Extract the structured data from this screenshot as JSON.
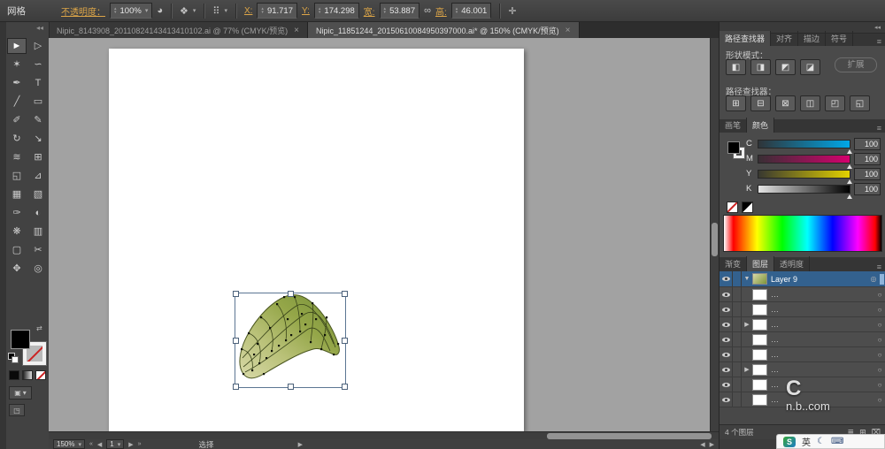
{
  "control_bar": {
    "selection_label": "网格",
    "opacity_label": "不透明度：",
    "opacity_value": "100%",
    "x_label": "X:",
    "x_value": "91.717",
    "y_label": "Y:",
    "y_value": "174.298",
    "w_label": "宽:",
    "w_value": "53.887",
    "h_label": "高:",
    "h_value": "46.001",
    "icons": {
      "opacity_circle": "◕",
      "style_drop": "❖",
      "align_grid": "⠿",
      "link": "∞",
      "transform": "✛",
      "dropdown": "▾",
      "up": "▴",
      "down": "▾"
    }
  },
  "tabs": [
    {
      "title": "Nipic_8143908_20110824143413410102.ai @ 77% (CMYK/预览)",
      "close": "×"
    },
    {
      "title": "Nipic_11851244_20150610084950397000.ai* @ 150% (CMYK/预览)",
      "close": "×"
    }
  ],
  "tool_panel": {
    "collapse": "◂◂"
  },
  "tools": [
    {
      "n": "selection",
      "g": "►"
    },
    {
      "n": "direct-selection",
      "g": "▷"
    },
    {
      "n": "magic-wand",
      "g": "✶"
    },
    {
      "n": "lasso",
      "g": "∽"
    },
    {
      "n": "pen",
      "g": "✒"
    },
    {
      "n": "type",
      "g": "T"
    },
    {
      "n": "line-segment",
      "g": "╱"
    },
    {
      "n": "rectangle",
      "g": "▭"
    },
    {
      "n": "paintbrush",
      "g": "✐"
    },
    {
      "n": "pencil",
      "g": "✎"
    },
    {
      "n": "rotate",
      "g": "↻"
    },
    {
      "n": "scale",
      "g": "↘"
    },
    {
      "n": "width-tool",
      "g": "≋"
    },
    {
      "n": "free-transform",
      "g": "⊞"
    },
    {
      "n": "shape-builder",
      "g": "◱"
    },
    {
      "n": "perspective-grid",
      "g": "⊿"
    },
    {
      "n": "mesh",
      "g": "▦"
    },
    {
      "n": "gradient",
      "g": "▧"
    },
    {
      "n": "eyedropper",
      "g": "✑"
    },
    {
      "n": "blend",
      "g": "◐"
    },
    {
      "n": "symbol-sprayer",
      "g": "❋"
    },
    {
      "n": "column-graph",
      "g": "▥"
    },
    {
      "n": "artboard",
      "g": "▢"
    },
    {
      "n": "slice",
      "g": "✂"
    },
    {
      "n": "hand",
      "g": "✥"
    },
    {
      "n": "zoom",
      "g": "◎"
    }
  ],
  "tool_extras": {
    "swap": "⇄",
    "mode_label": "▣",
    "mode_drop": "▾",
    "screen": "◳"
  },
  "right": {
    "collapse": "◂◂",
    "menu_icon": "≡",
    "panel_tabs_top": [
      "路径查找器",
      "对齐",
      "描边",
      "符号"
    ],
    "shape_modes_label": "形状模式：",
    "shape_mode_icons": [
      "◧",
      "◨",
      "◩",
      "◪"
    ],
    "expand_button": "扩展",
    "pathfinder_label": "路径查找器：",
    "pathfinder_icons": [
      "⊞",
      "⊟",
      "⊠",
      "◫",
      "◰",
      "◱"
    ],
    "panel_tabs_mid": [
      "画笔",
      "颜色"
    ],
    "channels": [
      {
        "label": "C",
        "value": "100"
      },
      {
        "label": "M",
        "value": "100"
      },
      {
        "label": "Y",
        "value": "100"
      },
      {
        "label": "K",
        "value": "100"
      }
    ],
    "panel_tabs_low": [
      "渐变",
      "图层",
      "透明度"
    ],
    "layers": {
      "expand_open": "▼",
      "selected_name": "Layer 9",
      "target_sel": "◎",
      "target": "○",
      "rows": [
        {
          "label": "…",
          "tri": ""
        },
        {
          "label": "…",
          "tri": ""
        },
        {
          "label": "…",
          "tri": "▶"
        },
        {
          "label": "…",
          "tri": ""
        },
        {
          "label": "…",
          "tri": ""
        },
        {
          "label": "…",
          "tri": "▶"
        },
        {
          "label": "…",
          "tri": ""
        },
        {
          "label": "…",
          "tri": ""
        }
      ],
      "footer": "4 个图层",
      "footer_icons": [
        "≣",
        "⊞",
        "⌧"
      ]
    }
  },
  "statusbar": {
    "zoom": "150%",
    "zoom_drop": "▾",
    "nav_first": "«",
    "nav_prev": "◀",
    "page": "1",
    "page_drop": "▾",
    "nav_next": "▶",
    "nav_last": "»",
    "tool_label": "选择",
    "arrow_mid": "▶",
    "arrow_left": "◀",
    "arrow_right": "▶"
  },
  "watermark": {
    "big": "C",
    "small": "n.b..com"
  },
  "ime": {
    "sogou": "S",
    "lang": "英",
    "moon": "☾",
    "kbd": "⌨"
  },
  "colors": {
    "selection_blue": "#33618e",
    "link_orange": "#dca548",
    "artboard": "#ffffff"
  }
}
